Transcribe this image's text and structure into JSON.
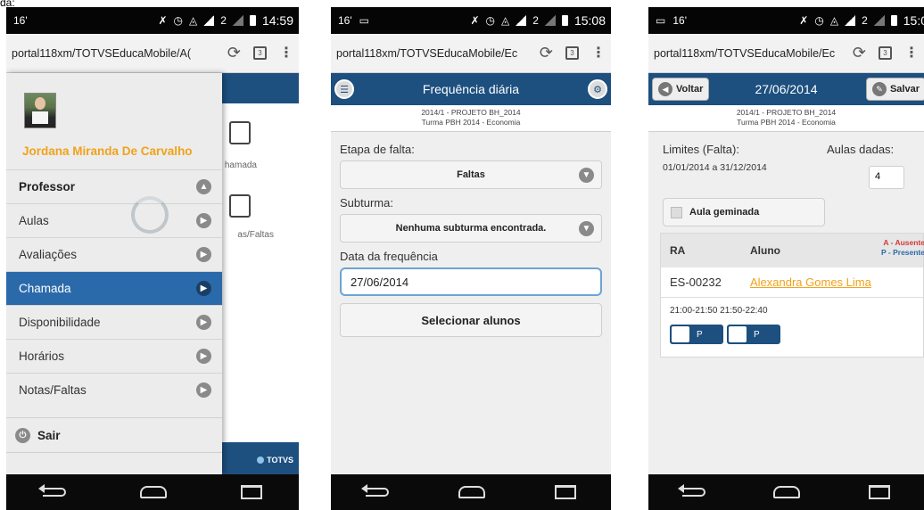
{
  "caption": "da:",
  "phone1": {
    "status": {
      "left": [
        "16'"
      ],
      "time": "14:59",
      "net": "2"
    },
    "url": "portal118xm/TOTVSEducaMobile/A(",
    "tabs_count": "3",
    "user_name": "Jordana Miranda De Carvalho",
    "menu": [
      {
        "label": "Professor",
        "type": "header",
        "icon": "chevron-up-icon"
      },
      {
        "label": "Aulas",
        "type": "item"
      },
      {
        "label": "Avaliações",
        "type": "item"
      },
      {
        "label": "Chamada",
        "type": "active"
      },
      {
        "label": "Disponibilidade",
        "type": "item"
      },
      {
        "label": "Horários",
        "type": "item"
      },
      {
        "label": "Notas/Faltas",
        "type": "item"
      }
    ],
    "logout": "Sair",
    "underlying": {
      "chamada": "hamada",
      "notas": "as/Faltas",
      "brand": "TOTVS"
    }
  },
  "phone2": {
    "status": {
      "left": [
        "16'"
      ],
      "time": "15:08",
      "net": "2"
    },
    "url": "portal118xm/TOTVSEducaMobile/Ec",
    "tabs_count": "3",
    "title": "Frequência diária",
    "sub1": "2014/1 - PROJETO BH_2014",
    "sub2": "Turma PBH 2014 - Economia",
    "label_etapa": "Etapa de falta:",
    "etapa_value": "Faltas",
    "label_subturma": "Subturma:",
    "subturma_value": "Nenhuma subturma encontrada.",
    "label_data": "Data da frequência",
    "date_value": "27/06/2014",
    "select_button": "Selecionar alunos"
  },
  "phone3": {
    "status": {
      "left": [
        "16'"
      ],
      "time": "15:0",
      "net": "2"
    },
    "url": "portal118xm/TOTVSEducaMobile/Ec",
    "tabs_count": "3",
    "back_button": "Voltar",
    "title": "27/06/2014",
    "save_button": "Salvar",
    "sub1": "2014/1 - PROJETO BH_2014",
    "sub2": "Turma PBH 2014 - Economia",
    "limits_label": "Limites (Falta):",
    "limits_value": "01/01/2014 a 31/12/2014",
    "aulas_label": "Aulas dadas:",
    "aulas_value": "4",
    "geminada": "Aula geminada",
    "table": {
      "col_ra": "RA",
      "col_aluno": "Aluno",
      "legend_a": "A - Ausente",
      "legend_p": "P - Presente",
      "rows": [
        {
          "ra": "ES-00232",
          "aluno": "Alexandra Gomes Lima"
        }
      ],
      "times": "21:00-21:50 21:50-22:40",
      "p1": "P",
      "p2": "P"
    }
  }
}
